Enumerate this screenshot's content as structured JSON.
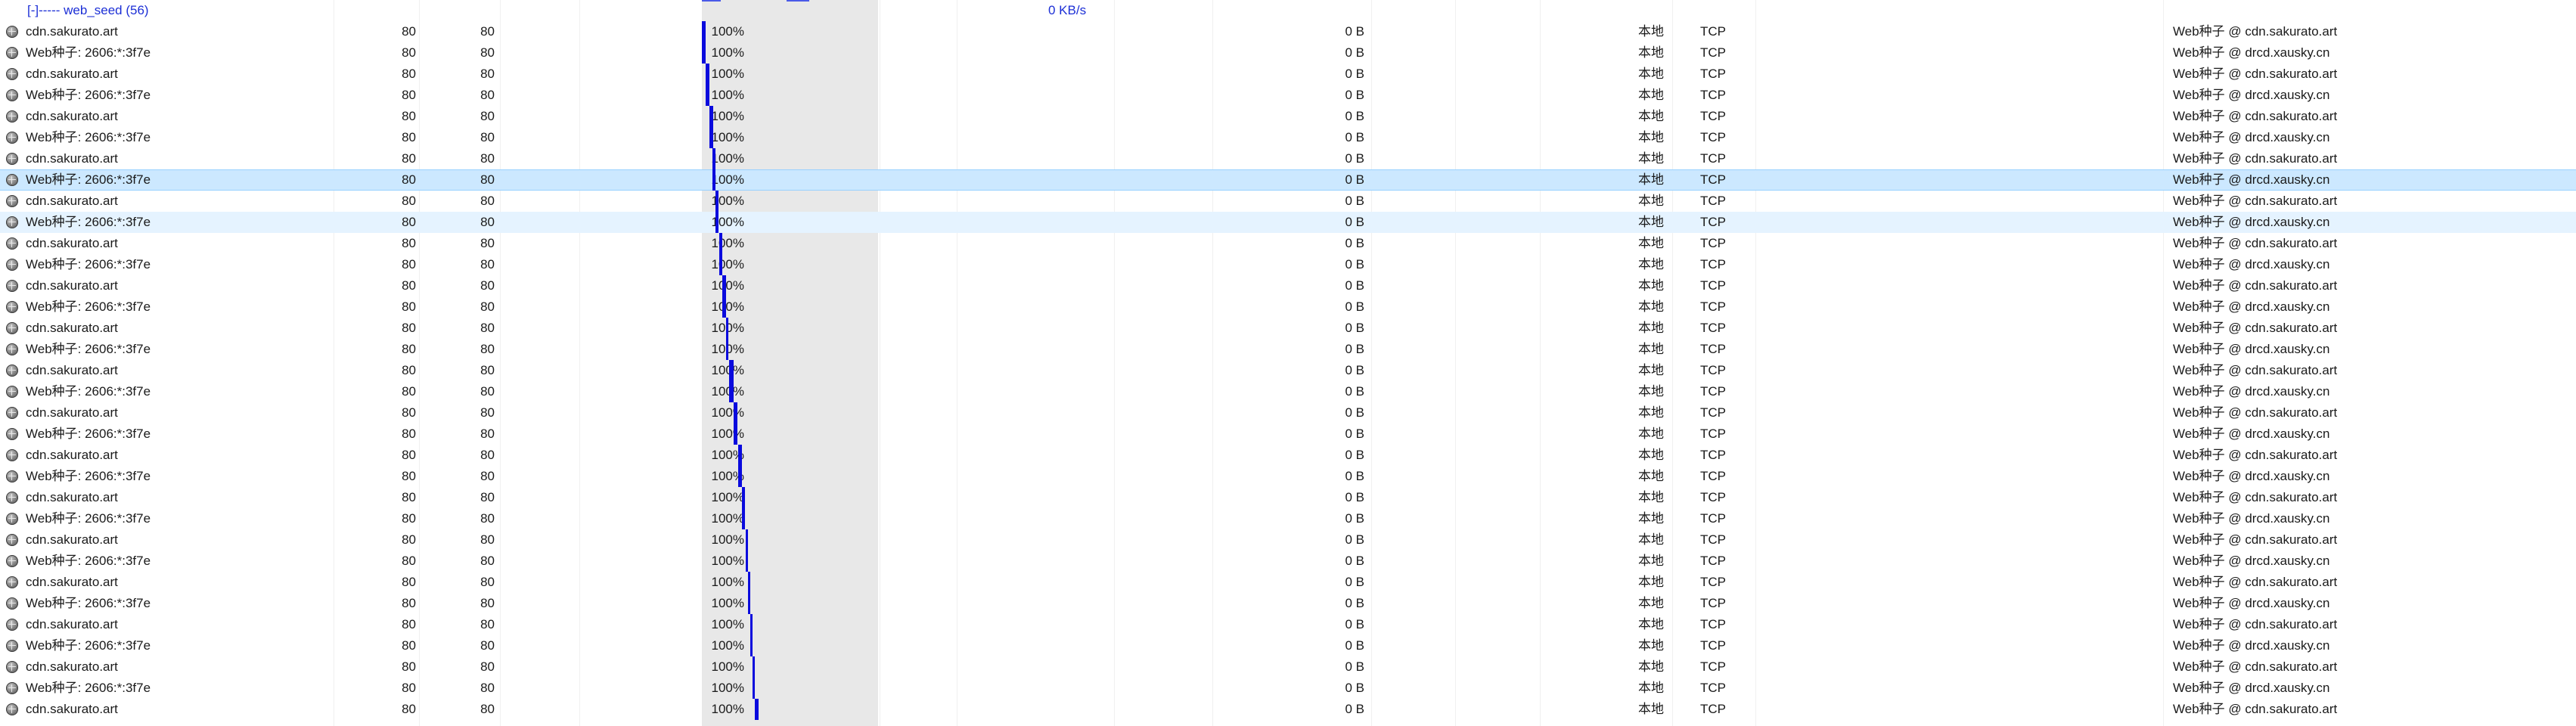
{
  "group": {
    "title": "[-]----- web_seed (56)",
    "speed": "0 KB/s"
  },
  "colors": {
    "group_text": "#1c2fd6",
    "piece_fill": "#0a0add",
    "piece_bg": "#e8e8e8",
    "selected_row": "#cce8ff",
    "hover_row": "#e5f3ff"
  },
  "row_icon": "globe-icon",
  "selected_row_index": 7,
  "hover_row_index": 9,
  "rows": [
    {
      "name": "cdn.sakurato.art",
      "port1": "80",
      "port2": "80",
      "progress": "100%",
      "downloaded": "0 B",
      "source": "本地",
      "protocol": "TCP",
      "client": "Web种子 @ cdn.sakurato.art",
      "piece_start": 0.0,
      "piece_span": 0.022
    },
    {
      "name": "Web种子: 2606:*:3f7e",
      "port1": "80",
      "port2": "80",
      "progress": "100%",
      "downloaded": "0 B",
      "source": "本地",
      "protocol": "TCP",
      "client": "Web种子 @ drcd.xausky.cn",
      "piece_start": 0.0,
      "piece_span": 0.022
    },
    {
      "name": "cdn.sakurato.art",
      "port1": "80",
      "port2": "80",
      "progress": "100%",
      "downloaded": "0 B",
      "source": "本地",
      "protocol": "TCP",
      "client": "Web种子 @ cdn.sakurato.art",
      "piece_start": 0.022,
      "piece_span": 0.022
    },
    {
      "name": "Web种子: 2606:*:3f7e",
      "port1": "80",
      "port2": "80",
      "progress": "100%",
      "downloaded": "0 B",
      "source": "本地",
      "protocol": "TCP",
      "client": "Web种子 @ drcd.xausky.cn",
      "piece_start": 0.022,
      "piece_span": 0.022
    },
    {
      "name": "cdn.sakurato.art",
      "port1": "80",
      "port2": "80",
      "progress": "100%",
      "downloaded": "0 B",
      "source": "本地",
      "protocol": "TCP",
      "client": "Web种子 @ cdn.sakurato.art",
      "piece_start": 0.044,
      "piece_span": 0.02
    },
    {
      "name": "Web种子: 2606:*:3f7e",
      "port1": "80",
      "port2": "80",
      "progress": "100%",
      "downloaded": "0 B",
      "source": "本地",
      "protocol": "TCP",
      "client": "Web种子 @ drcd.xausky.cn",
      "piece_start": 0.044,
      "piece_span": 0.02
    },
    {
      "name": "cdn.sakurato.art",
      "port1": "80",
      "port2": "80",
      "progress": "100%",
      "downloaded": "0 B",
      "source": "本地",
      "protocol": "TCP",
      "client": "Web种子 @ cdn.sakurato.art",
      "piece_start": 0.062,
      "piece_span": 0.014
    },
    {
      "name": "Web种子: 2606:*:3f7e",
      "port1": "80",
      "port2": "80",
      "progress": "100%",
      "downloaded": "0 B",
      "source": "本地",
      "protocol": "TCP",
      "client": "Web种子 @ drcd.xausky.cn",
      "piece_start": 0.062,
      "piece_span": 0.014
    },
    {
      "name": "cdn.sakurato.art",
      "port1": "80",
      "port2": "80",
      "progress": "100%",
      "downloaded": "0 B",
      "source": "本地",
      "protocol": "TCP",
      "client": "Web种子 @ cdn.sakurato.art",
      "piece_start": 0.076,
      "piece_span": 0.02
    },
    {
      "name": "Web种子: 2606:*:3f7e",
      "port1": "80",
      "port2": "80",
      "progress": "100%",
      "downloaded": "0 B",
      "source": "本地",
      "protocol": "TCP",
      "client": "Web种子 @ drcd.xausky.cn",
      "piece_start": 0.076,
      "piece_span": 0.02
    },
    {
      "name": "cdn.sakurato.art",
      "port1": "80",
      "port2": "80",
      "progress": "100%",
      "downloaded": "0 B",
      "source": "本地",
      "protocol": "TCP",
      "client": "Web种子 @ cdn.sakurato.art",
      "piece_start": 0.098,
      "piece_span": 0.02
    },
    {
      "name": "Web种子: 2606:*:3f7e",
      "port1": "80",
      "port2": "80",
      "progress": "100%",
      "downloaded": "0 B",
      "source": "本地",
      "protocol": "TCP",
      "client": "Web种子 @ drcd.xausky.cn",
      "piece_start": 0.098,
      "piece_span": 0.02
    },
    {
      "name": "cdn.sakurato.art",
      "port1": "80",
      "port2": "80",
      "progress": "100%",
      "downloaded": "0 B",
      "source": "本地",
      "protocol": "TCP",
      "client": "Web种子 @ cdn.sakurato.art",
      "piece_start": 0.118,
      "piece_span": 0.018
    },
    {
      "name": "Web种子: 2606:*:3f7e",
      "port1": "80",
      "port2": "80",
      "progress": "100%",
      "downloaded": "0 B",
      "source": "本地",
      "protocol": "TCP",
      "client": "Web种子 @ drcd.xausky.cn",
      "piece_start": 0.118,
      "piece_span": 0.018
    },
    {
      "name": "cdn.sakurato.art",
      "port1": "80",
      "port2": "80",
      "progress": "100%",
      "downloaded": "0 B",
      "source": "本地",
      "protocol": "TCP",
      "client": "Web种子 @ cdn.sakurato.art",
      "piece_start": 0.136,
      "piece_span": 0.016
    },
    {
      "name": "Web种子: 2606:*:3f7e",
      "port1": "80",
      "port2": "80",
      "progress": "100%",
      "downloaded": "0 B",
      "source": "本地",
      "protocol": "TCP",
      "client": "Web种子 @ drcd.xausky.cn",
      "piece_start": 0.136,
      "piece_span": 0.016
    },
    {
      "name": "cdn.sakurato.art",
      "port1": "80",
      "port2": "80",
      "progress": "100%",
      "downloaded": "0 B",
      "source": "本地",
      "protocol": "TCP",
      "client": "Web种子 @ cdn.sakurato.art",
      "piece_start": 0.156,
      "piece_span": 0.026
    },
    {
      "name": "Web种子: 2606:*:3f7e",
      "port1": "80",
      "port2": "80",
      "progress": "100%",
      "downloaded": "0 B",
      "source": "本地",
      "protocol": "TCP",
      "client": "Web种子 @ drcd.xausky.cn",
      "piece_start": 0.156,
      "piece_span": 0.026
    },
    {
      "name": "cdn.sakurato.art",
      "port1": "80",
      "port2": "80",
      "progress": "100%",
      "downloaded": "0 B",
      "source": "本地",
      "protocol": "TCP",
      "client": "Web种子 @ cdn.sakurato.art",
      "piece_start": 0.18,
      "piece_span": 0.022
    },
    {
      "name": "Web种子: 2606:*:3f7e",
      "port1": "80",
      "port2": "80",
      "progress": "100%",
      "downloaded": "0 B",
      "source": "本地",
      "protocol": "TCP",
      "client": "Web种子 @ drcd.xausky.cn",
      "piece_start": 0.18,
      "piece_span": 0.022
    },
    {
      "name": "cdn.sakurato.art",
      "port1": "80",
      "port2": "80",
      "progress": "100%",
      "downloaded": "0 B",
      "source": "本地",
      "protocol": "TCP",
      "client": "Web种子 @ cdn.sakurato.art",
      "piece_start": 0.204,
      "piece_span": 0.022
    },
    {
      "name": "Web种子: 2606:*:3f7e",
      "port1": "80",
      "port2": "80",
      "progress": "100%",
      "downloaded": "0 B",
      "source": "本地",
      "protocol": "TCP",
      "client": "Web种子 @ drcd.xausky.cn",
      "piece_start": 0.204,
      "piece_span": 0.022
    },
    {
      "name": "cdn.sakurato.art",
      "port1": "80",
      "port2": "80",
      "progress": "100%",
      "downloaded": "0 B",
      "source": "本地",
      "protocol": "TCP",
      "client": "Web种子 @ cdn.sakurato.art",
      "piece_start": 0.226,
      "piece_span": 0.02
    },
    {
      "name": "Web种子: 2606:*:3f7e",
      "port1": "80",
      "port2": "80",
      "progress": "100%",
      "downloaded": "0 B",
      "source": "本地",
      "protocol": "TCP",
      "client": "Web种子 @ drcd.xausky.cn",
      "piece_start": 0.226,
      "piece_span": 0.02
    },
    {
      "name": "cdn.sakurato.art",
      "port1": "80",
      "port2": "80",
      "progress": "100%",
      "downloaded": "0 B",
      "source": "本地",
      "protocol": "TCP",
      "client": "Web种子 @ cdn.sakurato.art",
      "piece_start": 0.25,
      "piece_span": 0.012
    },
    {
      "name": "Web种子: 2606:*:3f7e",
      "port1": "80",
      "port2": "80",
      "progress": "100%",
      "downloaded": "0 B",
      "source": "本地",
      "protocol": "TCP",
      "client": "Web种子 @ drcd.xausky.cn",
      "piece_start": 0.25,
      "piece_span": 0.012
    },
    {
      "name": "cdn.sakurato.art",
      "port1": "80",
      "port2": "80",
      "progress": "100%",
      "downloaded": "0 B",
      "source": "本地",
      "protocol": "TCP",
      "client": "Web种子 @ cdn.sakurato.art",
      "piece_start": 0.262,
      "piece_span": 0.012
    },
    {
      "name": "Web种子: 2606:*:3f7e",
      "port1": "80",
      "port2": "80",
      "progress": "100%",
      "downloaded": "0 B",
      "source": "本地",
      "protocol": "TCP",
      "client": "Web种子 @ drcd.xausky.cn",
      "piece_start": 0.262,
      "piece_span": 0.012
    },
    {
      "name": "cdn.sakurato.art",
      "port1": "80",
      "port2": "80",
      "progress": "100%",
      "downloaded": "0 B",
      "source": "本地",
      "protocol": "TCP",
      "client": "Web种子 @ cdn.sakurato.art",
      "piece_start": 0.274,
      "piece_span": 0.014
    },
    {
      "name": "Web种子: 2606:*:3f7e",
      "port1": "80",
      "port2": "80",
      "progress": "100%",
      "downloaded": "0 B",
      "source": "本地",
      "protocol": "TCP",
      "client": "Web种子 @ drcd.xausky.cn",
      "piece_start": 0.274,
      "piece_span": 0.014
    },
    {
      "name": "cdn.sakurato.art",
      "port1": "80",
      "port2": "80",
      "progress": "100%",
      "downloaded": "0 B",
      "source": "本地",
      "protocol": "TCP",
      "client": "Web种子 @ cdn.sakurato.art",
      "piece_start": 0.288,
      "piece_span": 0.012
    },
    {
      "name": "Web种子: 2606:*:3f7e",
      "port1": "80",
      "port2": "80",
      "progress": "100%",
      "downloaded": "0 B",
      "source": "本地",
      "protocol": "TCP",
      "client": "Web种子 @ drcd.xausky.cn",
      "piece_start": 0.288,
      "piece_span": 0.012
    },
    {
      "name": "cdn.sakurato.art",
      "port1": "80",
      "port2": "80",
      "progress": "100%",
      "downloaded": "0 B",
      "source": "本地",
      "protocol": "TCP",
      "client": "Web种子 @ cdn.sakurato.art",
      "piece_start": 0.3,
      "piece_span": 0.02
    }
  ]
}
